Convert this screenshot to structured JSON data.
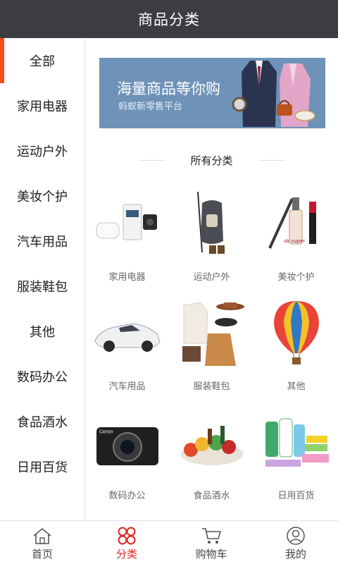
{
  "header": {
    "title": "商品分类"
  },
  "sidebar": {
    "items": [
      {
        "label": "全部",
        "active": true
      },
      {
        "label": "家用电器"
      },
      {
        "label": "运动户外"
      },
      {
        "label": "美妆个护"
      },
      {
        "label": "汽车用品"
      },
      {
        "label": "服装鞋包"
      },
      {
        "label": "其他"
      },
      {
        "label": "数码办公"
      },
      {
        "label": "食品酒水"
      },
      {
        "label": "日用百货"
      }
    ]
  },
  "banner": {
    "title": "海量商品等你购",
    "subtitle": "蚂蚁新零售平台"
  },
  "section": {
    "title": "所有分类"
  },
  "categories": [
    {
      "label": "家用电器"
    },
    {
      "label": "运动户外"
    },
    {
      "label": "美妆个护"
    },
    {
      "label": "汽车用品"
    },
    {
      "label": "服装鞋包"
    },
    {
      "label": "其他"
    },
    {
      "label": "数码办公"
    },
    {
      "label": "食品酒水"
    },
    {
      "label": "日用百货"
    }
  ],
  "tabbar": {
    "items": [
      {
        "label": "首页",
        "icon": "home-icon"
      },
      {
        "label": "分类",
        "icon": "category-icon",
        "active": true
      },
      {
        "label": "购物车",
        "icon": "cart-icon"
      },
      {
        "label": "我的",
        "icon": "user-icon"
      }
    ]
  },
  "colors": {
    "header_bg": "#3b3d42",
    "active_indicator": "#ff4a1a",
    "active_tab": "#e2231a",
    "banner_bg": "#6f92b8"
  }
}
